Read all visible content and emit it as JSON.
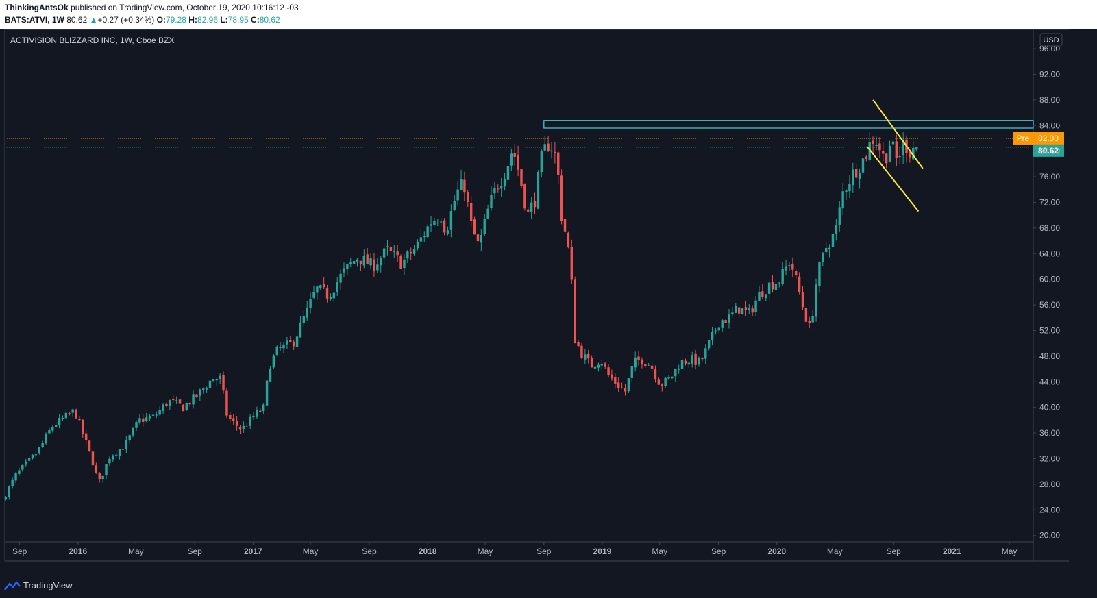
{
  "header": {
    "author": "ThinkingAntsOk",
    "published_text": "published on TradingView.com, October 19, 2020 10:16:12 -03",
    "symbol": "BATS:ATVI, 1W",
    "last": "80.62",
    "change": "+0.27 (+0.34%)",
    "o_label": "O:",
    "o_value": "79.28",
    "h_label": "H:",
    "h_value": "82.96",
    "l_label": "L:",
    "l_value": "78.95",
    "c_label": "C:",
    "c_value": "80.62"
  },
  "legend_title": "ACTIVISION BLIZZARD INC, 1W, Cboe BZX",
  "currency": "USD",
  "footer_brand": "TradingView",
  "colors": {
    "background": "#131722",
    "up": "#26a69a",
    "down": "#ef5350",
    "grid": "#2a2e39",
    "text": "#b2b5be",
    "zone": "#4dd0e1",
    "trendline": "#ffeb3b",
    "pre": "#ff9800"
  },
  "chart_data": {
    "type": "candlestick",
    "title": "ACTIVISION BLIZZARD INC, 1W, Cboe BZX",
    "x_tick_labels": [
      "Sep",
      "2016",
      "May",
      "Sep",
      "2017",
      "May",
      "Sep",
      "2018",
      "May",
      "Sep",
      "2019",
      "May",
      "Sep",
      "2020",
      "May",
      "Sep",
      "2021",
      "May"
    ],
    "y_tick_labels": [
      "96.00",
      "92.00",
      "88.00",
      "84.00",
      "80.00",
      "76.00",
      "72.00",
      "68.00",
      "64.00",
      "60.00",
      "56.00",
      "52.00",
      "48.00",
      "44.00",
      "40.00",
      "36.00",
      "32.00",
      "28.00",
      "24.00",
      "20.00"
    ],
    "y_range": [
      19,
      99
    ],
    "x_range": [
      "2015-08-01",
      "2021-06-20"
    ],
    "price_path": [
      [
        "2015-08-03",
        25.5
      ],
      [
        "2015-09-01",
        29.5
      ],
      [
        "2015-10-15",
        33.0
      ],
      [
        "2015-11-15",
        37.0
      ],
      [
        "2016-01-01",
        39.5
      ],
      [
        "2016-02-10",
        31.0
      ],
      [
        "2016-02-20",
        28.0
      ],
      [
        "2016-03-15",
        32.5
      ],
      [
        "2016-04-15",
        34.0
      ],
      [
        "2016-05-15",
        38.0
      ],
      [
        "2016-06-15",
        38.5
      ],
      [
        "2016-07-15",
        41.0
      ],
      [
        "2016-08-15",
        40.0
      ],
      [
        "2016-09-15",
        42.0
      ],
      [
        "2016-10-15",
        44.5
      ],
      [
        "2016-11-01",
        44.5
      ],
      [
        "2016-11-15",
        38.5
      ],
      [
        "2016-12-15",
        36.5
      ],
      [
        "2017-01-15",
        39.0
      ],
      [
        "2017-02-01",
        40.0
      ],
      [
        "2017-02-10",
        46.5
      ],
      [
        "2017-03-01",
        49.0
      ],
      [
        "2017-04-01",
        50.0
      ],
      [
        "2017-05-01",
        55.0
      ],
      [
        "2017-05-20",
        58.5
      ],
      [
        "2017-06-15",
        57.5
      ],
      [
        "2017-07-15",
        61.0
      ],
      [
        "2017-08-15",
        63.5
      ],
      [
        "2017-09-15",
        62.0
      ],
      [
        "2017-10-15",
        64.5
      ],
      [
        "2017-11-15",
        62.5
      ],
      [
        "2017-12-15",
        65.0
      ],
      [
        "2018-01-15",
        69.0
      ],
      [
        "2018-02-05",
        70.0
      ],
      [
        "2018-02-15",
        67.5
      ],
      [
        "2018-03-10",
        73.5
      ],
      [
        "2018-03-25",
        75.0
      ],
      [
        "2018-04-10",
        68.0
      ],
      [
        "2018-04-25",
        65.0
      ],
      [
        "2018-05-15",
        71.0
      ],
      [
        "2018-06-01",
        74.5
      ],
      [
        "2018-06-20",
        77.0
      ],
      [
        "2018-07-05",
        80.5
      ],
      [
        "2018-07-20",
        76.0
      ],
      [
        "2018-08-05",
        70.0
      ],
      [
        "2018-08-20",
        72.5
      ],
      [
        "2018-09-05",
        79.5
      ],
      [
        "2018-09-20",
        81.5
      ],
      [
        "2018-10-05",
        78.5
      ],
      [
        "2018-10-15",
        70.0
      ],
      [
        "2018-10-25",
        66.5
      ],
      [
        "2018-11-03",
        62.5
      ],
      [
        "2018-11-10",
        51.0
      ],
      [
        "2018-11-25",
        48.5
      ],
      [
        "2018-12-15",
        46.5
      ],
      [
        "2019-01-05",
        47.5
      ],
      [
        "2019-01-20",
        45.0
      ],
      [
        "2019-02-10",
        43.5
      ],
      [
        "2019-02-25",
        42.5
      ],
      [
        "2019-03-15",
        47.0
      ],
      [
        "2019-04-01",
        47.5
      ],
      [
        "2019-04-20",
        46.5
      ],
      [
        "2019-05-10",
        43.5
      ],
      [
        "2019-05-30",
        44.5
      ],
      [
        "2019-06-20",
        47.0
      ],
      [
        "2019-07-10",
        47.5
      ],
      [
        "2019-08-01",
        47.0
      ],
      [
        "2019-08-20",
        50.0
      ],
      [
        "2019-09-10",
        53.5
      ],
      [
        "2019-10-01",
        54.0
      ],
      [
        "2019-10-20",
        55.5
      ],
      [
        "2019-11-10",
        54.5
      ],
      [
        "2019-12-01",
        57.5
      ],
      [
        "2019-12-20",
        59.0
      ],
      [
        "2020-01-15",
        60.0
      ],
      [
        "2020-02-05",
        63.0
      ],
      [
        "2020-02-20",
        59.0
      ],
      [
        "2020-03-05",
        55.0
      ],
      [
        "2020-03-18",
        52.0
      ],
      [
        "2020-04-01",
        60.5
      ],
      [
        "2020-04-20",
        65.0
      ],
      [
        "2020-05-10",
        67.5
      ],
      [
        "2020-05-25",
        73.5
      ],
      [
        "2020-06-10",
        76.0
      ],
      [
        "2020-06-25",
        77.5
      ],
      [
        "2020-07-10",
        79.0
      ],
      [
        "2020-07-25",
        82.0
      ],
      [
        "2020-08-05",
        81.5
      ],
      [
        "2020-08-20",
        78.5
      ],
      [
        "2020-09-01",
        81.5
      ],
      [
        "2020-09-15",
        78.5
      ],
      [
        "2020-09-30",
        81.5
      ],
      [
        "2020-10-12",
        80.0
      ],
      [
        "2020-10-19",
        80.62
      ]
    ],
    "resistance_zone": {
      "from": "2018-09-01",
      "upper": 84.8,
      "lower": 83.6
    },
    "trendlines": [
      {
        "from": [
          "2020-07-20",
          88.0
        ],
        "to": [
          "2020-11-01",
          77.3
        ]
      },
      {
        "from": [
          "2020-07-08",
          80.7
        ],
        "to": [
          "2020-10-23",
          70.6
        ]
      }
    ],
    "price_lines": [
      {
        "label": "Pre",
        "value": 82.0,
        "text": "82.00"
      },
      {
        "label": "",
        "value": 80.62,
        "text": "80.62"
      }
    ],
    "grid": false,
    "legend": "top-left"
  }
}
